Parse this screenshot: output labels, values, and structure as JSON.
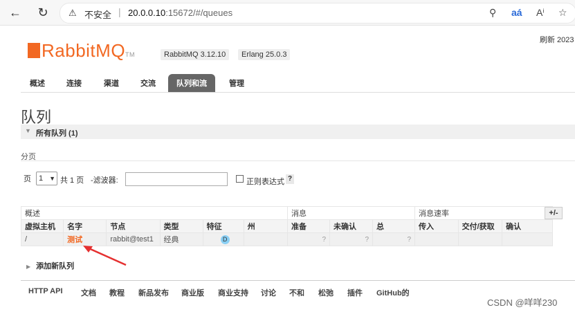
{
  "browser": {
    "insecure_label": "不安全",
    "url_host": "20.0.0.10",
    "url_path": ":15672/#/queues"
  },
  "header": {
    "logo_text": "RabbitMQ",
    "logo_tm": "TM",
    "rabbitmq_version": "RabbitMQ 3.12.10",
    "erlang_version": "Erlang 25.0.3",
    "refresh_label": "刷新 2023"
  },
  "tabs": [
    {
      "label": "概述"
    },
    {
      "label": "连接"
    },
    {
      "label": "渠道"
    },
    {
      "label": "交流"
    },
    {
      "label": "队列和流"
    },
    {
      "label": "管理"
    }
  ],
  "page": {
    "title": "队列",
    "section_title": "所有队列 (1)",
    "pagination_label": "分页"
  },
  "filter": {
    "page_label": "页",
    "page_value": "1",
    "total_label": "共 1 页",
    "filter_label": "-滤波器:",
    "regex_label": "正则表达式",
    "help_label": "?"
  },
  "table": {
    "groups": [
      "概述",
      "消息",
      "消息速率"
    ],
    "toggle_label": "+/-",
    "columns": [
      "虚拟主机",
      "名字",
      "节点",
      "类型",
      "特征",
      "州",
      "准备",
      "未确认",
      "总",
      "传入",
      "交付/获取",
      "确认"
    ],
    "rows": [
      {
        "vhost": "/",
        "name": "测试",
        "node": "rabbit@test1",
        "type": "经典",
        "feature": "D",
        "state": "",
        "ready": "?",
        "unacked": "?",
        "total": "?",
        "incoming": "",
        "deliver": "",
        "ack": ""
      }
    ]
  },
  "add_queue_label": "添加新队列",
  "footer_links": [
    "HTTP API",
    "文档",
    "教程",
    "新品发布",
    "商业版",
    "商业支持",
    "讨论",
    "不和",
    "松弛",
    "插件",
    "GitHub的"
  ],
  "watermark": "CSDN @咩咩230",
  "colors": {
    "brand": "#f26822",
    "tab_active": "#666666",
    "feature_badge": "#8ad0f5"
  }
}
